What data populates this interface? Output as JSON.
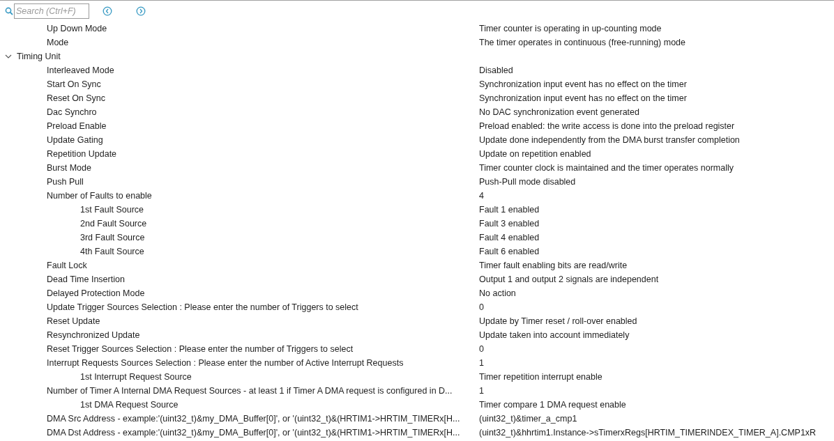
{
  "toolbar": {
    "search": {
      "placeholder": "Search (Ctrl+F)"
    }
  },
  "groups": [
    {
      "children": [
        {
          "label": "Up Down Mode",
          "value": "Timer counter is operating in up-counting mode"
        },
        {
          "label": "Mode",
          "value": "The timer operates in continuous (free-running) mode"
        }
      ]
    },
    {
      "label": "Timing Unit",
      "expanded": true,
      "children": [
        {
          "label": "Interleaved Mode",
          "value": "Disabled"
        },
        {
          "label": "Start On Sync",
          "value": "Synchronization input event has no effect on the timer"
        },
        {
          "label": "Reset On Sync",
          "value": "Synchronization input event has no effect on the timer"
        },
        {
          "label": "Dac Synchro",
          "value": "No DAC synchronization event generated"
        },
        {
          "label": "Preload Enable",
          "value": "Preload enabled: the write access is done into the preload register"
        },
        {
          "label": "Update Gating",
          "value": "Update done independently from the DMA burst transfer completion"
        },
        {
          "label": "Repetition Update",
          "value": "Update on repetition enabled"
        },
        {
          "label": "Burst Mode",
          "value": "Timer counter clock is maintained and the timer operates normally"
        },
        {
          "label": "Push Pull",
          "value": "Push-Pull mode disabled"
        },
        {
          "label": "Number of Faults to enable",
          "value": "4",
          "children": [
            {
              "label": "1st Fault Source",
              "value": "Fault 1 enabled"
            },
            {
              "label": "2nd Fault Source",
              "value": "Fault 3 enabled"
            },
            {
              "label": "3rd Fault Source",
              "value": "Fault 4 enabled"
            },
            {
              "label": "4th Fault Source",
              "value": "Fault 6 enabled"
            }
          ]
        },
        {
          "label": "Fault Lock",
          "value": "Timer fault enabling bits are read/write"
        },
        {
          "label": "Dead Time Insertion",
          "value": "Output 1 and output 2 signals are independent"
        },
        {
          "label": "Delayed Protection Mode",
          "value": "No action"
        },
        {
          "label": "Update Trigger Sources Selection : Please enter the number of Triggers to select",
          "value": "0"
        },
        {
          "label": "Reset Update",
          "value": "Update by Timer reset / roll-over enabled"
        },
        {
          "label": "Resynchronized Update",
          "value": "Update taken into account immediately"
        },
        {
          "label": "Reset Trigger Sources Selection : Please enter the number of Triggers to select",
          "value": "0"
        },
        {
          "label": "Interrupt Requests Sources Selection : Please enter the number of Active Interrupt Requests",
          "value": "1",
          "children": [
            {
              "label": "1st Interrupt Request Source",
              "value": "Timer repetition interrupt enable"
            }
          ]
        },
        {
          "label": "Number of Timer A Internal DMA Request Sources - at least 1 if Timer A DMA request is configured in D...",
          "value": "1",
          "children": [
            {
              "label": "1st DMA Request Source",
              "value": "Timer compare 1 DMA request enable"
            }
          ]
        },
        {
          "label": "DMA Src Address - example:'(uint32_t)&my_DMA_Buffer[0]', or '(uint32_t)&(HRTIM1->HRTIM_TIMERx[H...",
          "value": "(uint32_t)&timer_a_cmp1"
        },
        {
          "label": "DMA Dst Address - example:'(uint32_t)&my_DMA_Buffer[0]', or '(uint32_t)&(HRTIM1->HRTIM_TIMERx[H...",
          "value": "(uint32_t)&hhrtim1.Instance->sTimerxRegs[HRTIM_TIMERINDEX_TIMER_A].CMP1xR"
        }
      ]
    }
  ]
}
